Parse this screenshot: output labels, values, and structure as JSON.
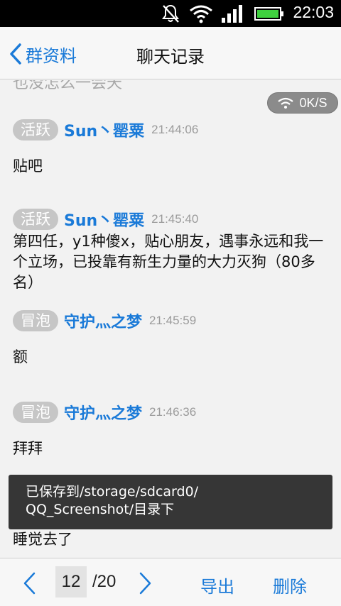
{
  "status_bar": {
    "time": "22:03",
    "icons": [
      "mute-icon",
      "wifi-icon",
      "signal-icon",
      "battery-icon"
    ]
  },
  "header": {
    "back_label": "群资料",
    "title": "聊天记录"
  },
  "chat": {
    "cut_off_text": "也没怎么一会天",
    "network_speed": "0K/S",
    "messages": [
      {
        "badge": "活跃",
        "sender": "Sun丶罂粟",
        "time": "21:44:06",
        "text": "贴吧"
      },
      {
        "badge": "活跃",
        "sender": "Sun丶罂粟",
        "time": "21:45:40",
        "text": "第四任，y1种傻x，贴心朋友，遇事永远和我一个立场，已投靠有新生力量的大力灭狗（80多名）"
      },
      {
        "badge": "冒泡",
        "sender": "守护灬之梦",
        "time": "21:45:59",
        "text": "额"
      },
      {
        "badge": "冒泡",
        "sender": "守护灬之梦",
        "time": "21:46:36",
        "text": "拜拜"
      },
      {
        "text": "睡觉去了"
      }
    ]
  },
  "toast": {
    "line1": "已保存到/storage/sdcard0/",
    "line2": "QQ_Screenshot/目录下"
  },
  "bottom_bar": {
    "current_page": "12",
    "total_pages": "/20",
    "export_label": "导出",
    "delete_label": "删除"
  },
  "colors": {
    "accent": "#1a7ad8",
    "badge_bg": "#c6c6c6",
    "timestamp": "#9b9b9b"
  }
}
